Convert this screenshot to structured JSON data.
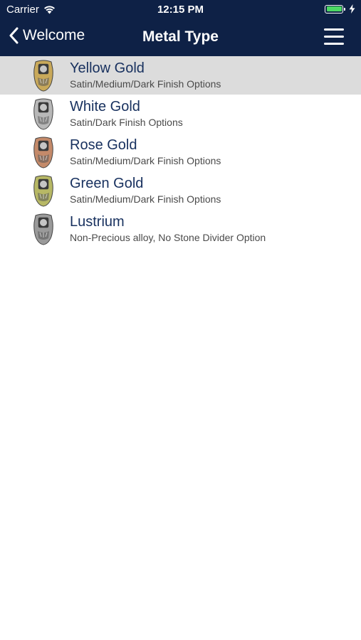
{
  "status_bar": {
    "carrier": "Carrier",
    "time": "12:15 PM",
    "battery_level": 1.0,
    "battery_color": "#4cd964"
  },
  "nav": {
    "back_label": "Welcome",
    "title": "Metal Type",
    "menu_icon": "hamburger-menu-icon",
    "background": "#0e2146"
  },
  "metals": [
    {
      "title": "Yellow Gold",
      "subtitle": "Satin/Medium/Dark Finish Options",
      "selected": true,
      "ring_color": "#c9a95a"
    },
    {
      "title": "White Gold",
      "subtitle": "Satin/Dark Finish Options",
      "selected": false,
      "ring_color": "#b8b8b8"
    },
    {
      "title": "Rose Gold",
      "subtitle": "Satin/Medium/Dark Finish Options",
      "selected": false,
      "ring_color": "#c48a6a"
    },
    {
      "title": "Green Gold",
      "subtitle": "Satin/Medium/Dark Finish Options",
      "selected": false,
      "ring_color": "#b7b865"
    },
    {
      "title": "Lustrium",
      "subtitle": "Non-Precious alloy, No Stone Divider Option",
      "selected": false,
      "ring_color": "#9a9a9a"
    }
  ]
}
